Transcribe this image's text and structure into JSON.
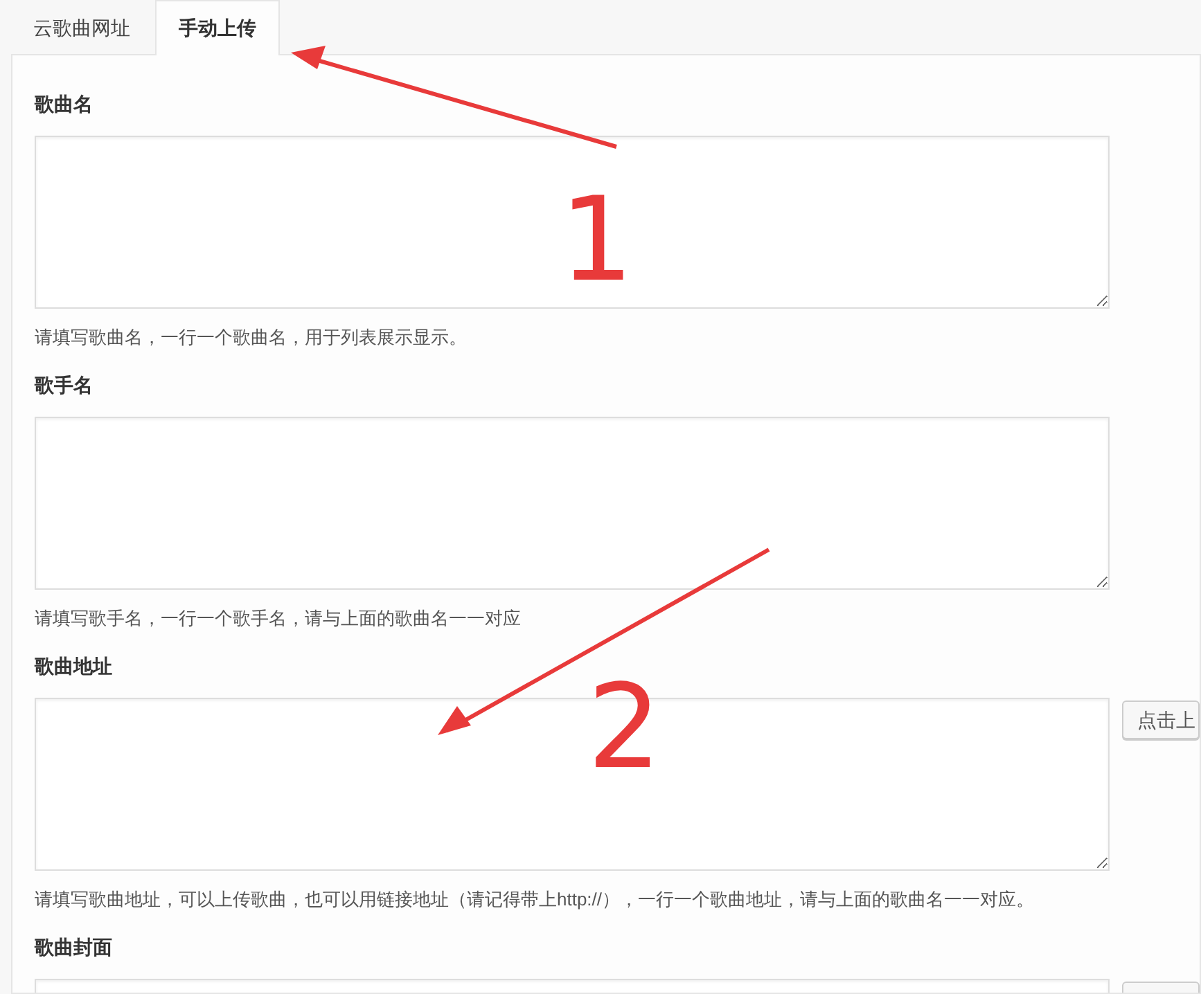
{
  "tabs": [
    {
      "label": "云歌曲网址",
      "selected": false
    },
    {
      "label": "手动上传",
      "selected": true
    }
  ],
  "fields": [
    {
      "label": "歌曲名",
      "upload_button": false,
      "help": "请填写歌曲名，一行一个歌曲名，用于列表展示显示。"
    },
    {
      "label": "歌手名",
      "upload_button": false,
      "help": "请填写歌手名，一行一个歌手名，请与上面的歌曲名一一对应"
    },
    {
      "label": "歌曲地址",
      "upload_button": true,
      "button": "点击上",
      "help": "请填写歌曲地址，可以上传歌曲，也可以用链接地址（请记得带上http://），一行一个歌曲地址，请与上面的歌曲名一一对应。"
    },
    {
      "label": "歌曲封面",
      "upload_button": true
    }
  ],
  "annotations": [
    {
      "kind": "arrow"
    },
    {
      "kind": "number",
      "label": "1"
    },
    {
      "kind": "arrow"
    },
    {
      "kind": "number",
      "label": "2"
    }
  ]
}
